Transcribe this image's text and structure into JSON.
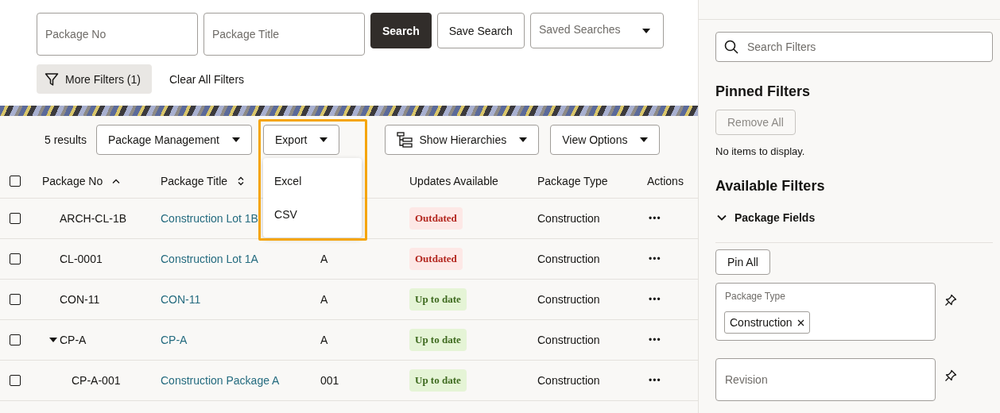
{
  "search_bar": {
    "package_no": {
      "placeholder": "Package No"
    },
    "package_title": {
      "placeholder": "Package Title"
    },
    "search_button": "Search",
    "save_search_button": "Save Search",
    "saved_searches": {
      "placeholder": "Saved Searches"
    },
    "more_filters_button": "More Filters (1)",
    "clear_filters_link": "Clear All Filters"
  },
  "toolbar": {
    "results": "5 results",
    "buttons": [
      {
        "label": "Package Management",
        "kind": "menu"
      },
      {
        "label": "Export",
        "kind": "export"
      },
      {
        "label": "Show Hierarchies",
        "kind": "hierarchy"
      },
      {
        "label": "View Options",
        "kind": "menu"
      }
    ],
    "export_menu": {
      "open": true,
      "highlighted": true,
      "items": [
        "Excel",
        "CSV"
      ]
    }
  },
  "table": {
    "select_all_checked": false,
    "columns": [
      {
        "label": "Package No",
        "kind": "sorted"
      },
      {
        "label": "Package Title",
        "kind": "sortable"
      },
      {
        "kind": "plain"
      },
      {
        "label": "Updates Available",
        "kind": "plain"
      },
      {
        "label": "Package Type",
        "kind": "plain"
      },
      {
        "label": "Actions",
        "kind": "plain"
      }
    ],
    "rows": [
      {
        "package_no": "ARCH-CL-1B",
        "package_title": "Construction Lot 1B",
        "kind": "outdated",
        "status_label": "Outdated",
        "package_type": "Construction",
        "actions": "•••",
        "checked": false
      },
      {
        "package_no": "CL-0001",
        "package_title": "Construction Lot 1A",
        "column_3": "A",
        "kind": "outdated",
        "status_label": "Outdated",
        "package_type": "Construction",
        "actions": "•••",
        "checked": false
      },
      {
        "package_no": "CON-11",
        "package_title": "CON-11",
        "column_3": "A",
        "kind": "current",
        "status_label": "Up to date",
        "package_type": "Construction",
        "actions": "•••",
        "checked": false
      },
      {
        "package_no": "CP-A",
        "package_title": "CP-A",
        "column_3": "A",
        "kind": "current",
        "status_label": "Up to date",
        "package_type": "Construction",
        "actions": "•••",
        "checked": false,
        "expanded": true,
        "children": [
          {
            "package_no": "CP-A-001",
            "package_title": "Construction Package A",
            "column_3": "001",
            "kind": "current",
            "status_label": "Up to date",
            "package_type": "Construction",
            "actions": "•••",
            "checked": false
          }
        ]
      }
    ]
  },
  "filter_panel": {
    "search": {
      "placeholder": "Search Filters"
    },
    "pinned_title": "Pinned Filters",
    "remove_all_button": {
      "label": "Remove All",
      "disabled": true
    },
    "pinned_empty": "No items to display.",
    "available_title": "Available Filters",
    "group": {
      "label": "Package Fields",
      "expanded": true
    },
    "pin_all_button": "Pin All",
    "fields": [
      {
        "label": "Package Type",
        "chips": [
          "Construction"
        ]
      },
      {
        "label": "Revision"
      }
    ]
  }
}
